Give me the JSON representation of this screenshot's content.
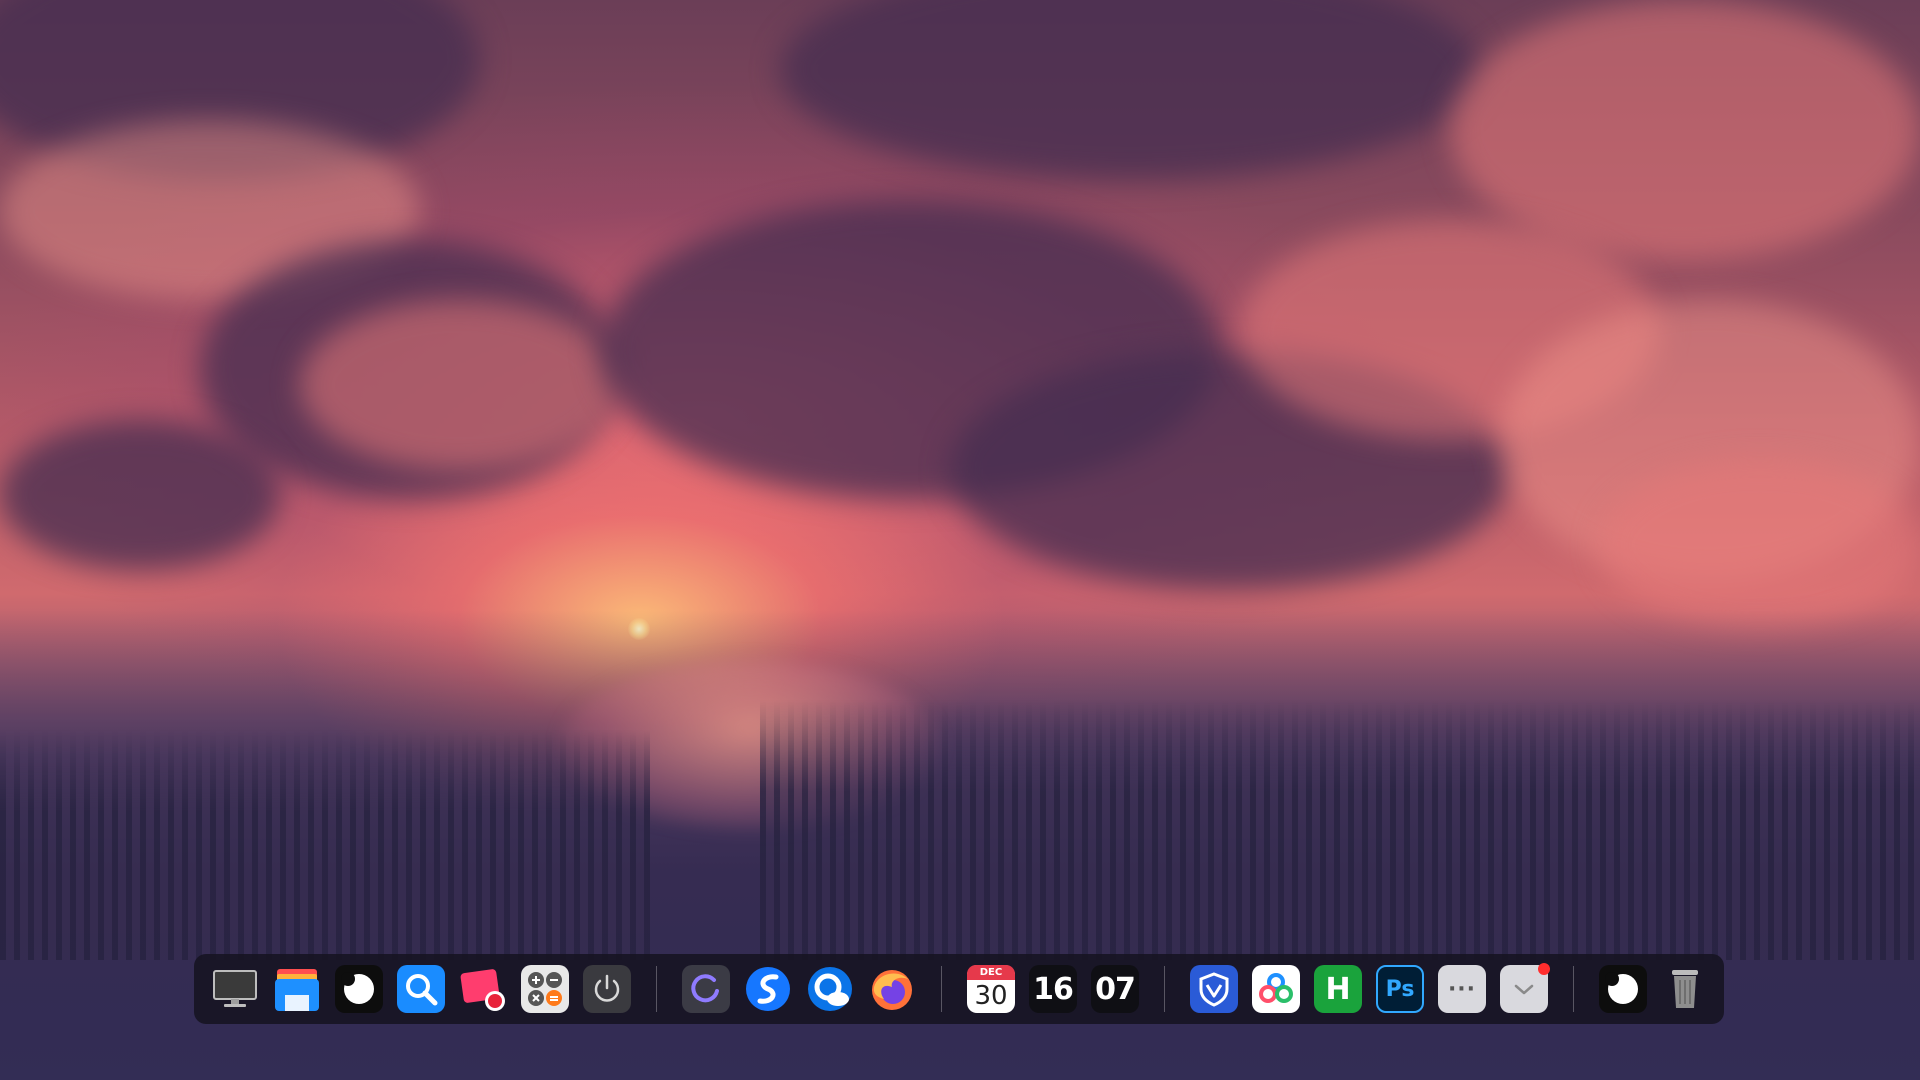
{
  "wallpaper": {
    "name": "sunset-forest-wallpaper"
  },
  "dock": {
    "group1": [
      {
        "name": "monitor-icon",
        "app": "desktop-display"
      },
      {
        "name": "file-manager-icon",
        "app": "file-manager"
      },
      {
        "name": "circle-app-icon",
        "app": "launcher"
      },
      {
        "name": "search-icon",
        "app": "search"
      },
      {
        "name": "screenshot-icon",
        "app": "screen-recorder"
      },
      {
        "name": "calculator-icon",
        "app": "calculator"
      },
      {
        "name": "power-icon",
        "app": "power"
      }
    ],
    "group2": [
      {
        "name": "loading-ring-icon",
        "app": "browser-loader"
      },
      {
        "name": "messaging-icon",
        "app": "messaging"
      },
      {
        "name": "weather-icon",
        "app": "weather"
      },
      {
        "name": "firefox-icon",
        "app": "firefox"
      }
    ],
    "group3": {
      "calendar": {
        "month": "DEC",
        "day": "30"
      },
      "clock": {
        "hours": "16",
        "minutes": "07"
      }
    },
    "group4": [
      {
        "name": "security-shield-icon",
        "app": "security"
      },
      {
        "name": "cloud-drive-icon",
        "app": "cloud-drive"
      },
      {
        "name": "h-app-icon",
        "app": "h-app",
        "letter": "H"
      },
      {
        "name": "photoshop-icon",
        "app": "photoshop",
        "letter": "Ps"
      },
      {
        "name": "more-icon",
        "app": "more",
        "letter": "···"
      },
      {
        "name": "inbox-icon",
        "app": "inbox",
        "badge": true
      }
    ],
    "group5": [
      {
        "name": "circle-app-icon",
        "app": "launcher-2"
      },
      {
        "name": "trash-icon",
        "app": "trash"
      }
    ]
  },
  "colors": {
    "dock_bg": "#16142299",
    "calendar_red": "#e6394b",
    "photoshop_blue": "#31a8ff",
    "h_green": "#1aa33c",
    "shield_blue": "#2a5bd7"
  }
}
